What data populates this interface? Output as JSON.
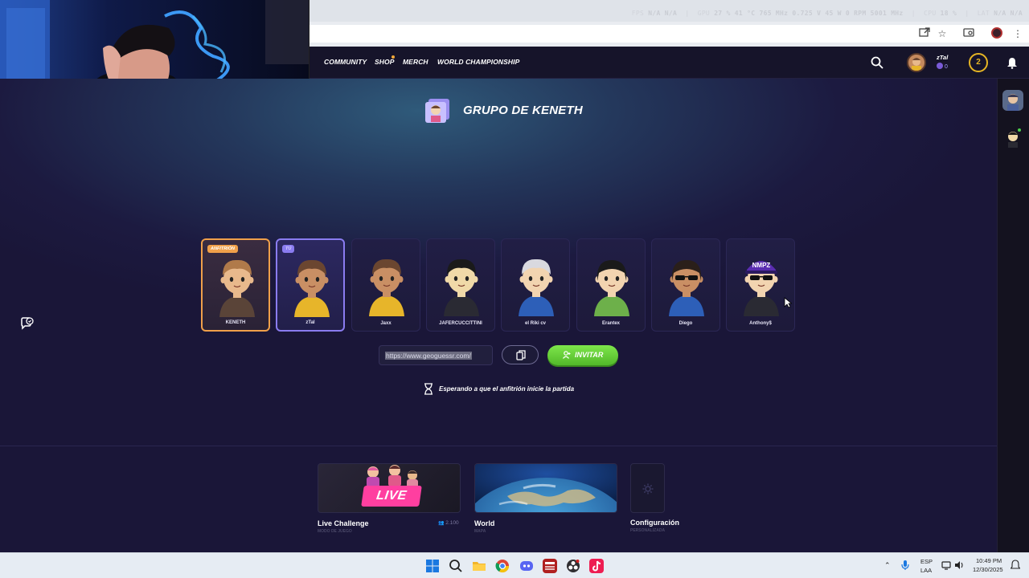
{
  "perf_overlay": {
    "fps_label": "FPS",
    "fps_value": "N/A",
    "fps_low": "N/A",
    "gpu_label": "GPU",
    "gpu_stats": "27 % 41 °C 765 MHz 0.725 V 45 W 0 RPM 5001 MHz",
    "cpu_label": "CPU",
    "cpu_stats": "18 %",
    "lat_label": "LAT",
    "lat_stats": "N/A N/A"
  },
  "nav": {
    "links": [
      "COMMUNITY",
      "SHOP",
      "MERCH",
      "WORLD CHAMPIONSHIP"
    ],
    "user_name": "zTal",
    "user_coins": "0",
    "level": "2"
  },
  "lobby": {
    "title": "GRUPO DE KENETH",
    "host_tag": "ANFITRIÓN",
    "me_tag": "TÚ",
    "players": [
      {
        "name": "KENETH",
        "role": "host",
        "skin": "#e8b98c",
        "hair": "#b07a4a",
        "shirt": "#5a4438"
      },
      {
        "name": "zTal",
        "role": "me",
        "skin": "#c98f64",
        "hair": "#6b4630",
        "shirt": "#e7b52a"
      },
      {
        "name": "Jaxx",
        "role": "",
        "skin": "#c98f64",
        "hair": "#6b4630",
        "shirt": "#e7b52a"
      },
      {
        "name": "JAFERCUCCITTINI",
        "role": "",
        "skin": "#f0d9a8",
        "hair": "#1a1a1a",
        "shirt": "#2a2a33"
      },
      {
        "name": "el Riki cv",
        "role": "",
        "skin": "#f2d4b0",
        "hair": "#d9d9df",
        "shirt": "#2d5fb8"
      },
      {
        "name": "Erantex",
        "role": "",
        "skin": "#f2d4b0",
        "hair": "#1a1a1a",
        "shirt": "#6db04a"
      },
      {
        "name": "Diego",
        "role": "",
        "skin": "#c98f64",
        "hair": "#2a1f1a",
        "shirt": "#2d5fb8"
      },
      {
        "name": "Anthony$",
        "role": "",
        "skin": "#f2d4b0",
        "hair": "#5a2db0",
        "shirt": "#2a2a33",
        "cap_text": "NMPZ"
      }
    ],
    "invite_url": "https://www.geoguessr.com/",
    "invite_button": "INVITAR",
    "waiting_text": "Esperando a que el anfitrión inicie la partida"
  },
  "modes": [
    {
      "name": "Live Challenge",
      "sub": "MODO DE JUEGO",
      "players": "2.100",
      "badge": "LIVE"
    },
    {
      "name": "World",
      "sub": "MAPA"
    },
    {
      "name": "Configuración",
      "sub": "PERSONALIZADA"
    }
  ],
  "taskbar": {
    "lang": "ESP",
    "layout": "LAA",
    "time": "10:49 PM",
    "date": "12/30/2025"
  }
}
